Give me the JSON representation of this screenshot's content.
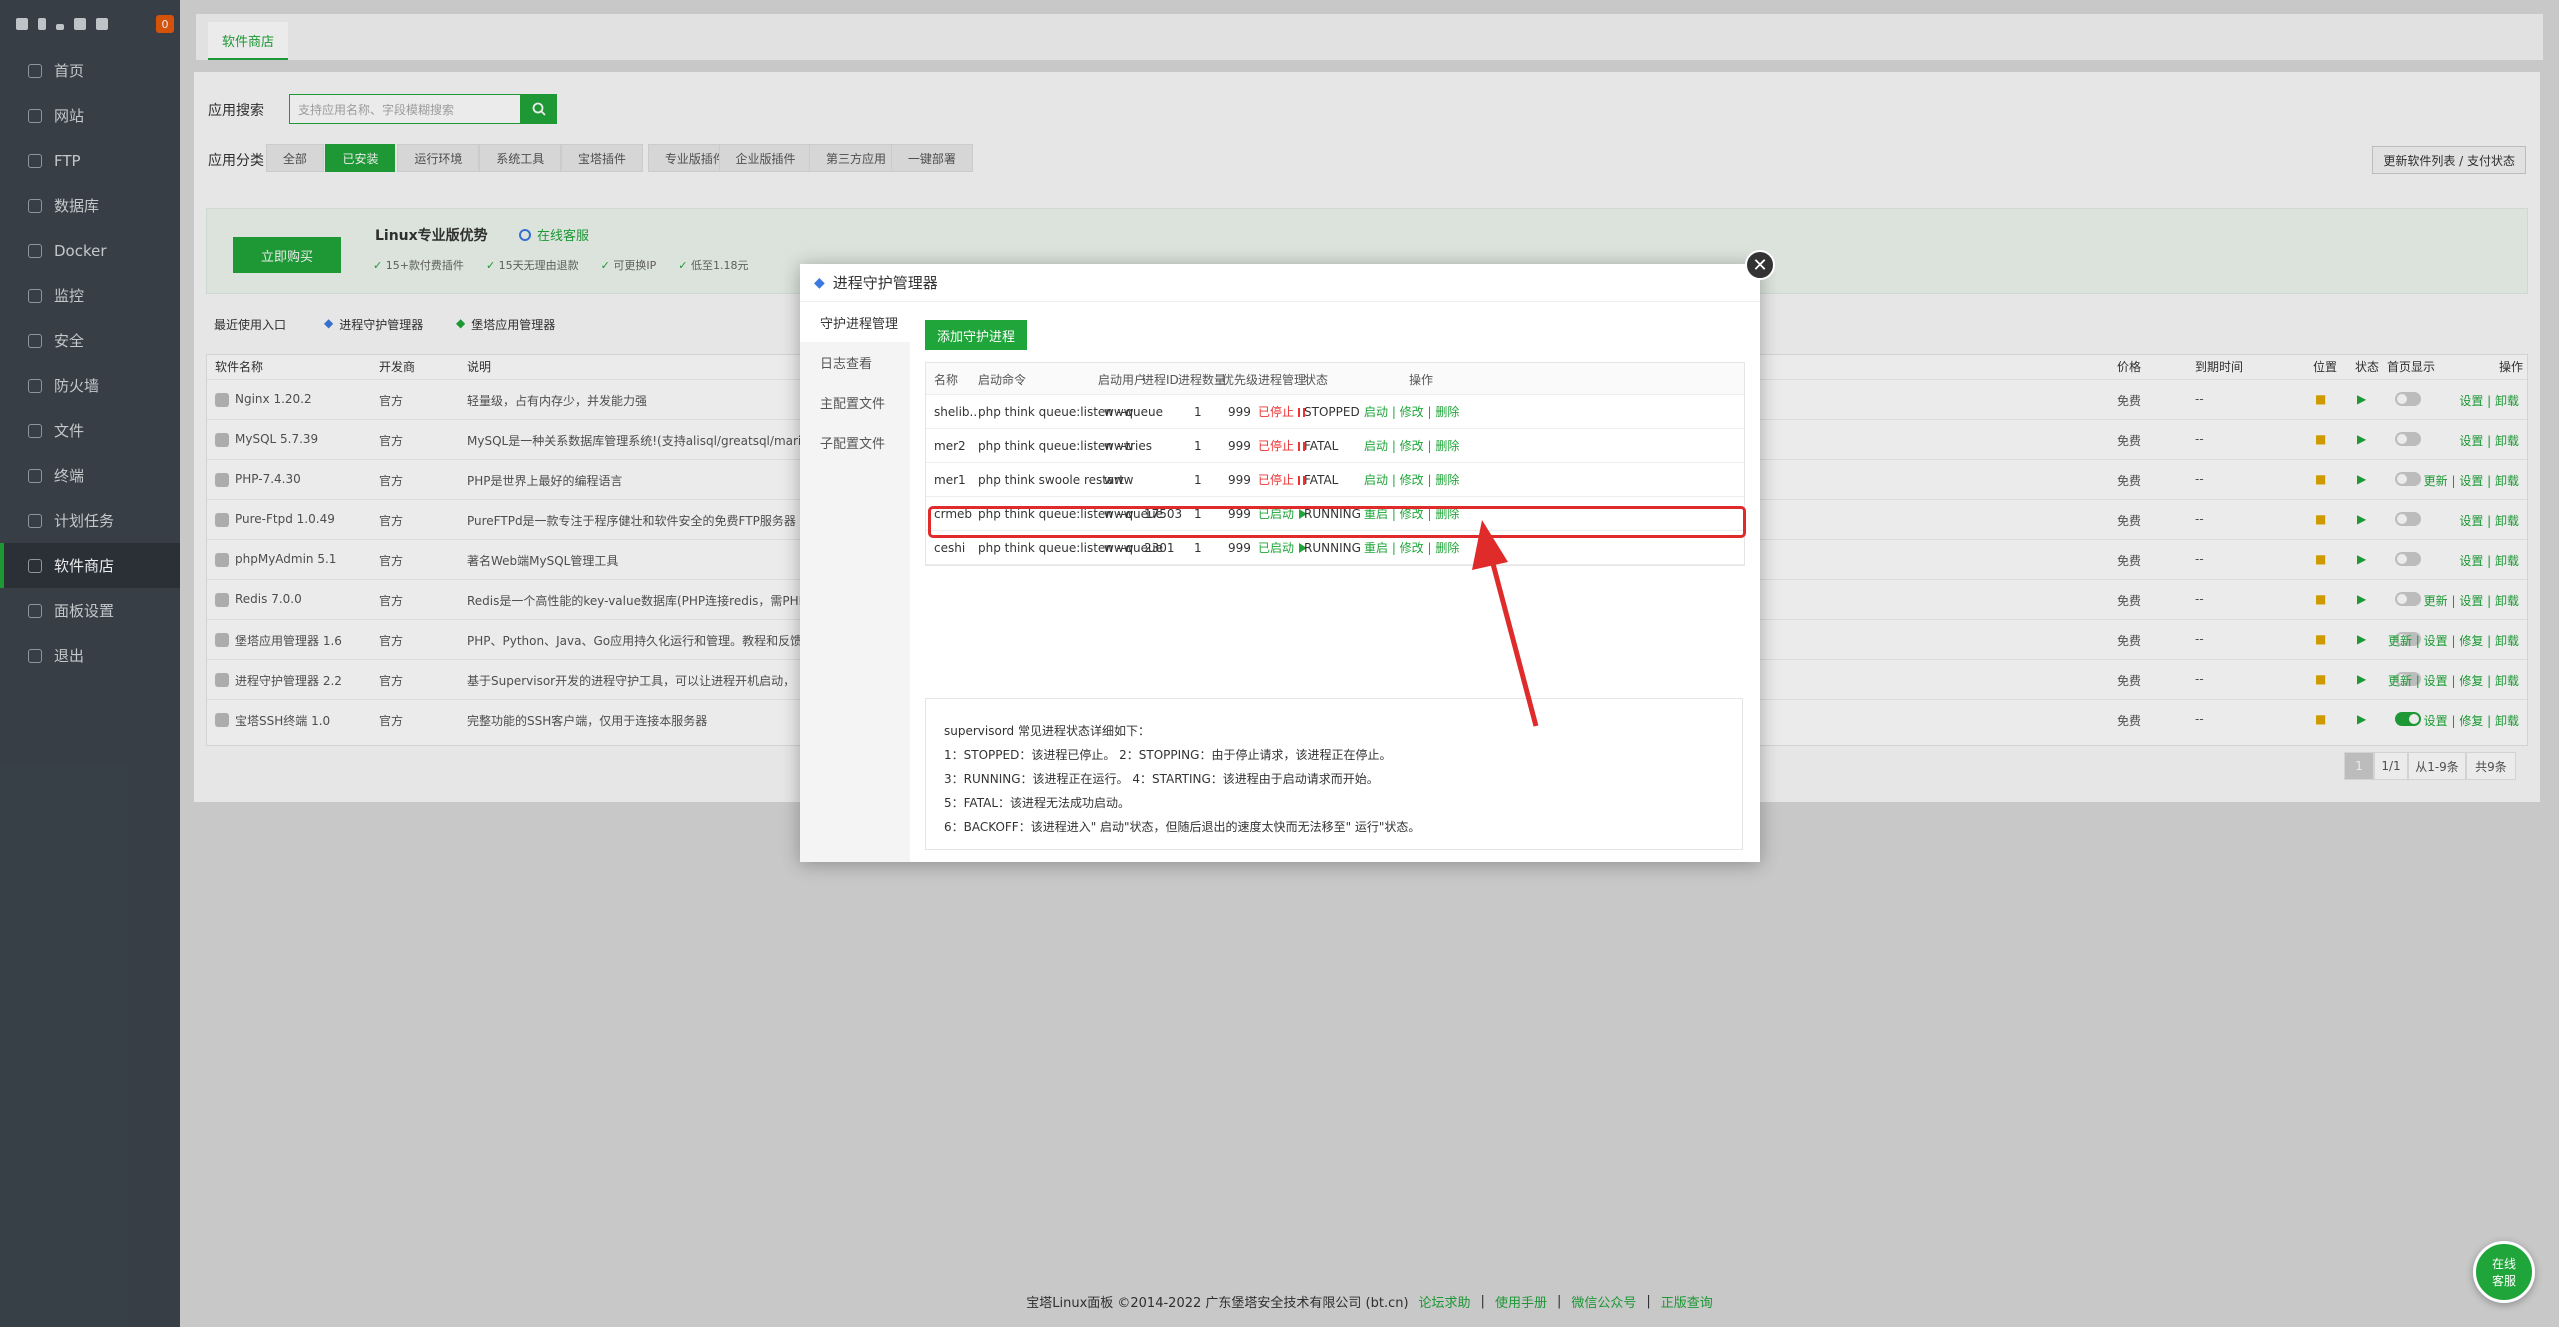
{
  "sidebar": {
    "badge": "0",
    "items": [
      {
        "label": "首页",
        "name": "home"
      },
      {
        "label": "网站",
        "name": "website"
      },
      {
        "label": "FTP",
        "name": "ftp"
      },
      {
        "label": "数据库",
        "name": "database"
      },
      {
        "label": "Docker",
        "name": "docker"
      },
      {
        "label": "监控",
        "name": "monitor"
      },
      {
        "label": "安全",
        "name": "security"
      },
      {
        "label": "防火墙",
        "name": "firewall"
      },
      {
        "label": "文件",
        "name": "files"
      },
      {
        "label": "终端",
        "name": "terminal"
      },
      {
        "label": "计划任务",
        "name": "cron"
      },
      {
        "label": "软件商店",
        "name": "store",
        "active": true
      },
      {
        "label": "面板设置",
        "name": "settings"
      },
      {
        "label": "退出",
        "name": "logout"
      }
    ]
  },
  "tab": "软件商店",
  "search": {
    "label": "应用搜索",
    "placeholder": "支持应用名称、字段模糊搜索"
  },
  "categories": {
    "label": "应用分类",
    "items": [
      "全部",
      "已安装",
      "运行环境",
      "系统工具",
      "宝塔插件",
      "专业版插件",
      "企业版插件",
      "第三方应用",
      "一键部署"
    ]
  },
  "update_btn": "更新软件列表 / 支付状态",
  "promo": {
    "buy": "立即购买",
    "title": "Linux专业版优势",
    "service": "在线客服",
    "f1": "15+款付费插件",
    "f2": "15天无理由退款",
    "f3": "可更换IP",
    "f4": "低至1.18元"
  },
  "recent": {
    "label": "最近使用入口",
    "a": "进程守护管理器",
    "b": "堡塔应用管理器"
  },
  "table": {
    "headers": {
      "name": "软件名称",
      "dev": "开发商",
      "desc": "说明",
      "price": "价格",
      "expire": "到期时间",
      "loc": "位置",
      "status": "状态",
      "home": "首页显示",
      "ops": "操作"
    },
    "rows": [
      {
        "name": "Nginx 1.20.2",
        "dev": "官方",
        "desc": "轻量级，占有内存少，并发能力强",
        "price": "免费",
        "expire": "--",
        "on": false,
        "ops": "设置 | 卸载"
      },
      {
        "name": "MySQL 5.7.39",
        "dev": "官方",
        "desc": "MySQL是一种关系数据库管理系统!(支持alisql/greatsql/mariad",
        "price": "免费",
        "expire": "--",
        "on": false,
        "ops": "设置 | 卸载"
      },
      {
        "name": "PHP-7.4.30",
        "dev": "官方",
        "desc": "PHP是世界上最好的编程语言",
        "price": "免费",
        "expire": "--",
        "on": false,
        "ops": "更新 | 设置 | 卸载"
      },
      {
        "name": "Pure-Ftpd 1.0.49",
        "dev": "官方",
        "desc": "PureFTPd是一款专注于程序健壮和软件安全的免费FTP服务器",
        "price": "免费",
        "expire": "--",
        "on": false,
        "ops": "设置 | 卸载"
      },
      {
        "name": "phpMyAdmin 5.1",
        "dev": "官方",
        "desc": "著名Web端MySQL管理工具",
        "price": "免费",
        "expire": "--",
        "on": false,
        "ops": "设置 | 卸载"
      },
      {
        "name": "Redis 7.0.0",
        "dev": "官方",
        "desc": "Redis是一个高性能的key-value数据库(PHP连接redis，需PHP",
        "price": "免费",
        "expire": "--",
        "on": false,
        "ops": "更新 | 设置 | 卸载"
      },
      {
        "name": "堡塔应用管理器 1.6",
        "dev": "官方",
        "desc": "PHP、Python、Java、Go应用持久化运行和管理。教程和反馈",
        "price": "免费",
        "expire": "--",
        "on": false,
        "ops": "更新 | 设置 | 修复 | 卸载"
      },
      {
        "name": "进程守护管理器 2.2",
        "dev": "官方",
        "desc": "基于Supervisor开发的进程守护工具，可以让进程开机启动，",
        "price": "免费",
        "expire": "--",
        "on": false,
        "ops": "更新 | 设置 | 修复 | 卸载"
      },
      {
        "name": "宝塔SSH终端 1.0",
        "dev": "官方",
        "desc": "完整功能的SSH客户端，仅用于连接本服务器",
        "price": "免费",
        "expire": "--",
        "on": true,
        "ops": "设置 | 修复 | 卸载"
      }
    ]
  },
  "pager": {
    "page": "1",
    "pages": "1/1",
    "range": "从1-9条",
    "total": "共9条"
  },
  "footer": {
    "copy": "宝塔Linux面板 ©2014-2022 广东堡塔安全技术有限公司 (bt.cn)",
    "l1": "论坛求助",
    "l2": "使用手册",
    "l3": "微信公众号",
    "l4": "正版查询"
  },
  "service": {
    "l1": "在线",
    "l2": "客服"
  },
  "modal": {
    "title": "进程守护管理器",
    "nav": [
      "守护进程管理",
      "日志查看",
      "主配置文件",
      "子配置文件"
    ],
    "add": "添加守护进程",
    "cols": [
      "名称",
      "启动命令",
      "启动用户",
      "进程ID",
      "进程数量",
      "优先级",
      "进程管理",
      "状态",
      "操作"
    ],
    "rows": [
      {
        "name": "shelib...",
        "cmd": "php think queue:listen --queue",
        "user": "www",
        "pid": "",
        "num": "1",
        "pri": "999",
        "pm": "已停止",
        "state": "STOPPED",
        "ops": "启动 | 修改 | 删除",
        "running": false
      },
      {
        "name": "mer2",
        "cmd": "php think queue:listen --tries",
        "user": "www",
        "pid": "",
        "num": "1",
        "pri": "999",
        "pm": "已停止",
        "state": "FATAL",
        "ops": "启动 | 修改 | 删除",
        "running": false
      },
      {
        "name": "mer1",
        "cmd": "php think swoole restart",
        "user": "www",
        "pid": "",
        "num": "1",
        "pri": "999",
        "pm": "已停止",
        "state": "FATAL",
        "ops": "启动 | 修改 | 删除",
        "running": false
      },
      {
        "name": "crmeb",
        "cmd": "php think queue:listen --queue",
        "user": "www",
        "pid": "17503",
        "num": "1",
        "pri": "999",
        "pm": "已启动",
        "state": "RUNNING",
        "ops": "重启 | 修改 | 删除",
        "running": true
      },
      {
        "name": "ceshi",
        "cmd": "php think queue:listen --queue",
        "user": "www",
        "pid": "2301",
        "num": "1",
        "pri": "999",
        "pm": "已启动",
        "state": "RUNNING",
        "ops": "重启 | 修改 | 删除",
        "running": true
      }
    ],
    "info": [
      "supervisord 常见进程状态详细如下：",
      "1：STOPPED：该进程已停止。    2：STOPPING：由于停止请求，该进程正在停止。",
      "3：RUNNING：该进程正在运行。 4：STARTING：该进程由于启动请求而开始。",
      "5：FATAL：该进程无法成功启动。",
      "6：BACKOFF：该进程进入\" 启动\"状态，但随后退出的速度太快而无法移至\" 运行\"状态。"
    ]
  },
  "colors": {
    "accent": "#20a53a",
    "danger": "#e33333",
    "sidebar": "#3c444d"
  }
}
